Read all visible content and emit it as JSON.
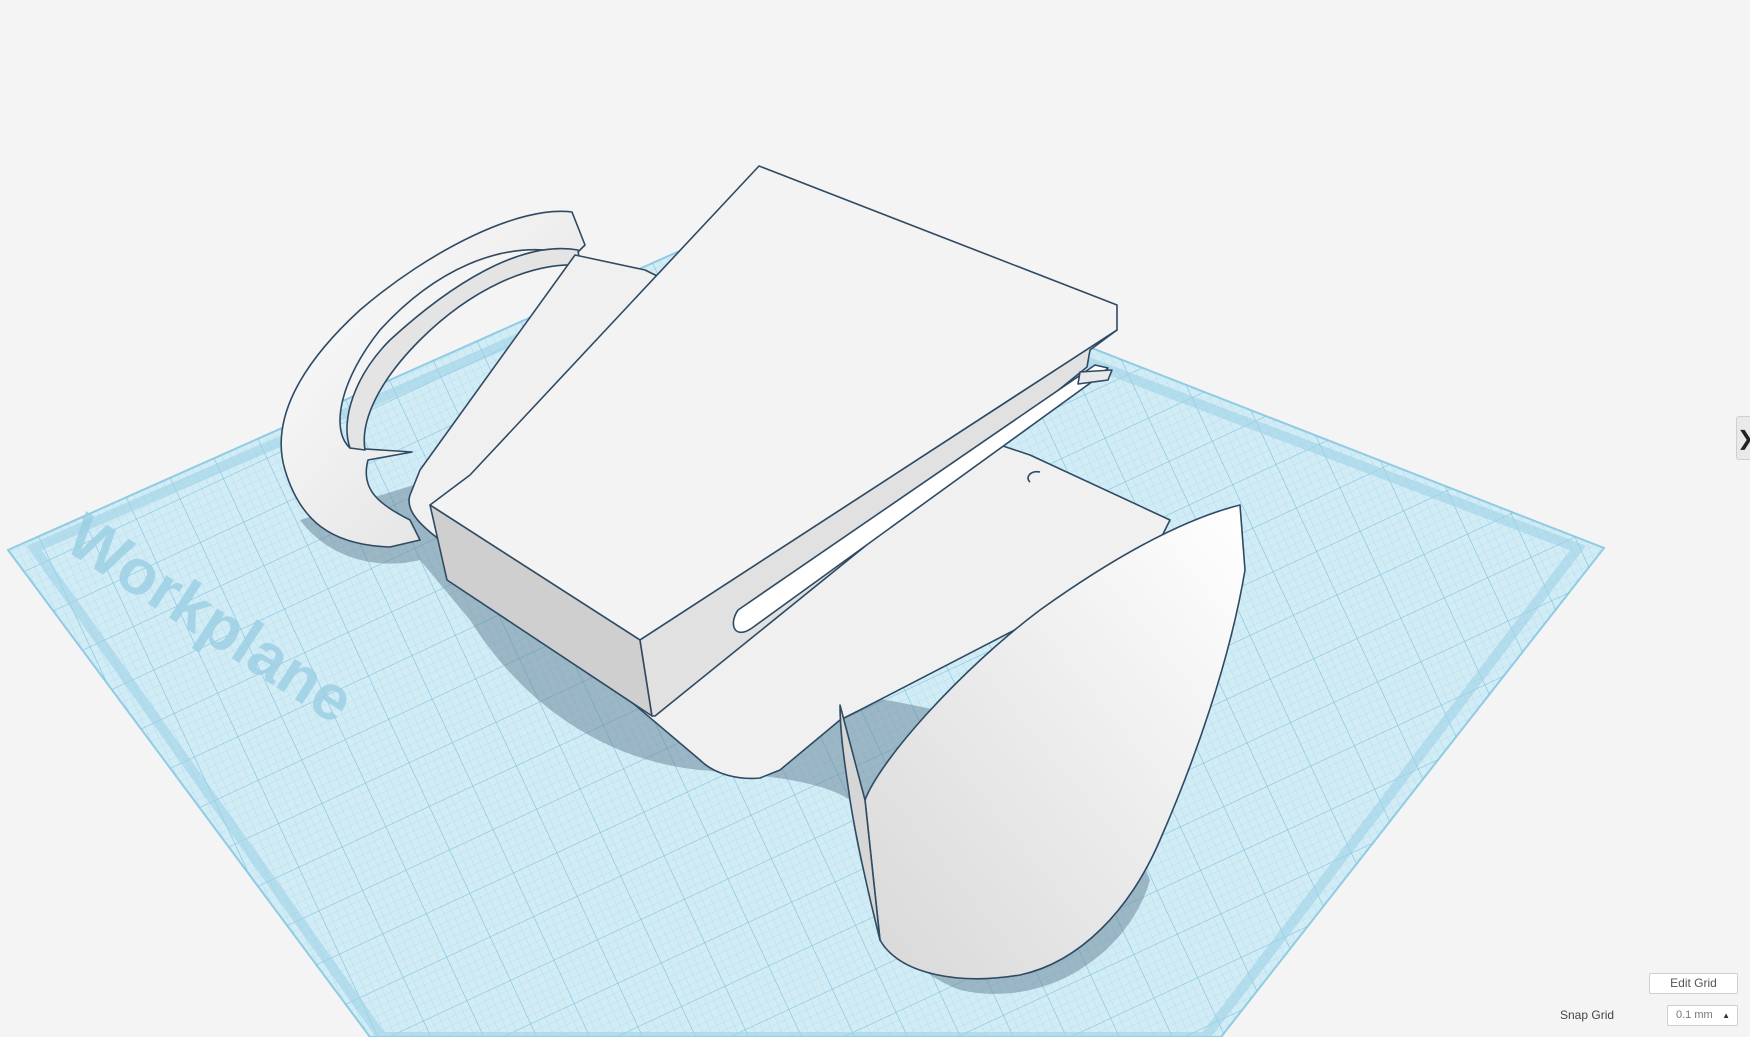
{
  "workplane": {
    "label": "Workplane"
  },
  "panel": {
    "toggle_icon": "chevron-right-icon",
    "toggle_glyph": "❯"
  },
  "grid_controls": {
    "edit_grid_label": "Edit Grid",
    "snap_grid_label": "Snap Grid",
    "snap_grid_value": "0.1 mm",
    "snap_grid_caret": "▲"
  },
  "colors": {
    "background": "#f4f4f4",
    "workplane_fill": "#d2ecf6",
    "grid_line": "#86c8e2",
    "model_fill": "#f2f2f2",
    "model_outline": "#2f4a63",
    "shadow": "#6e8a9c"
  }
}
